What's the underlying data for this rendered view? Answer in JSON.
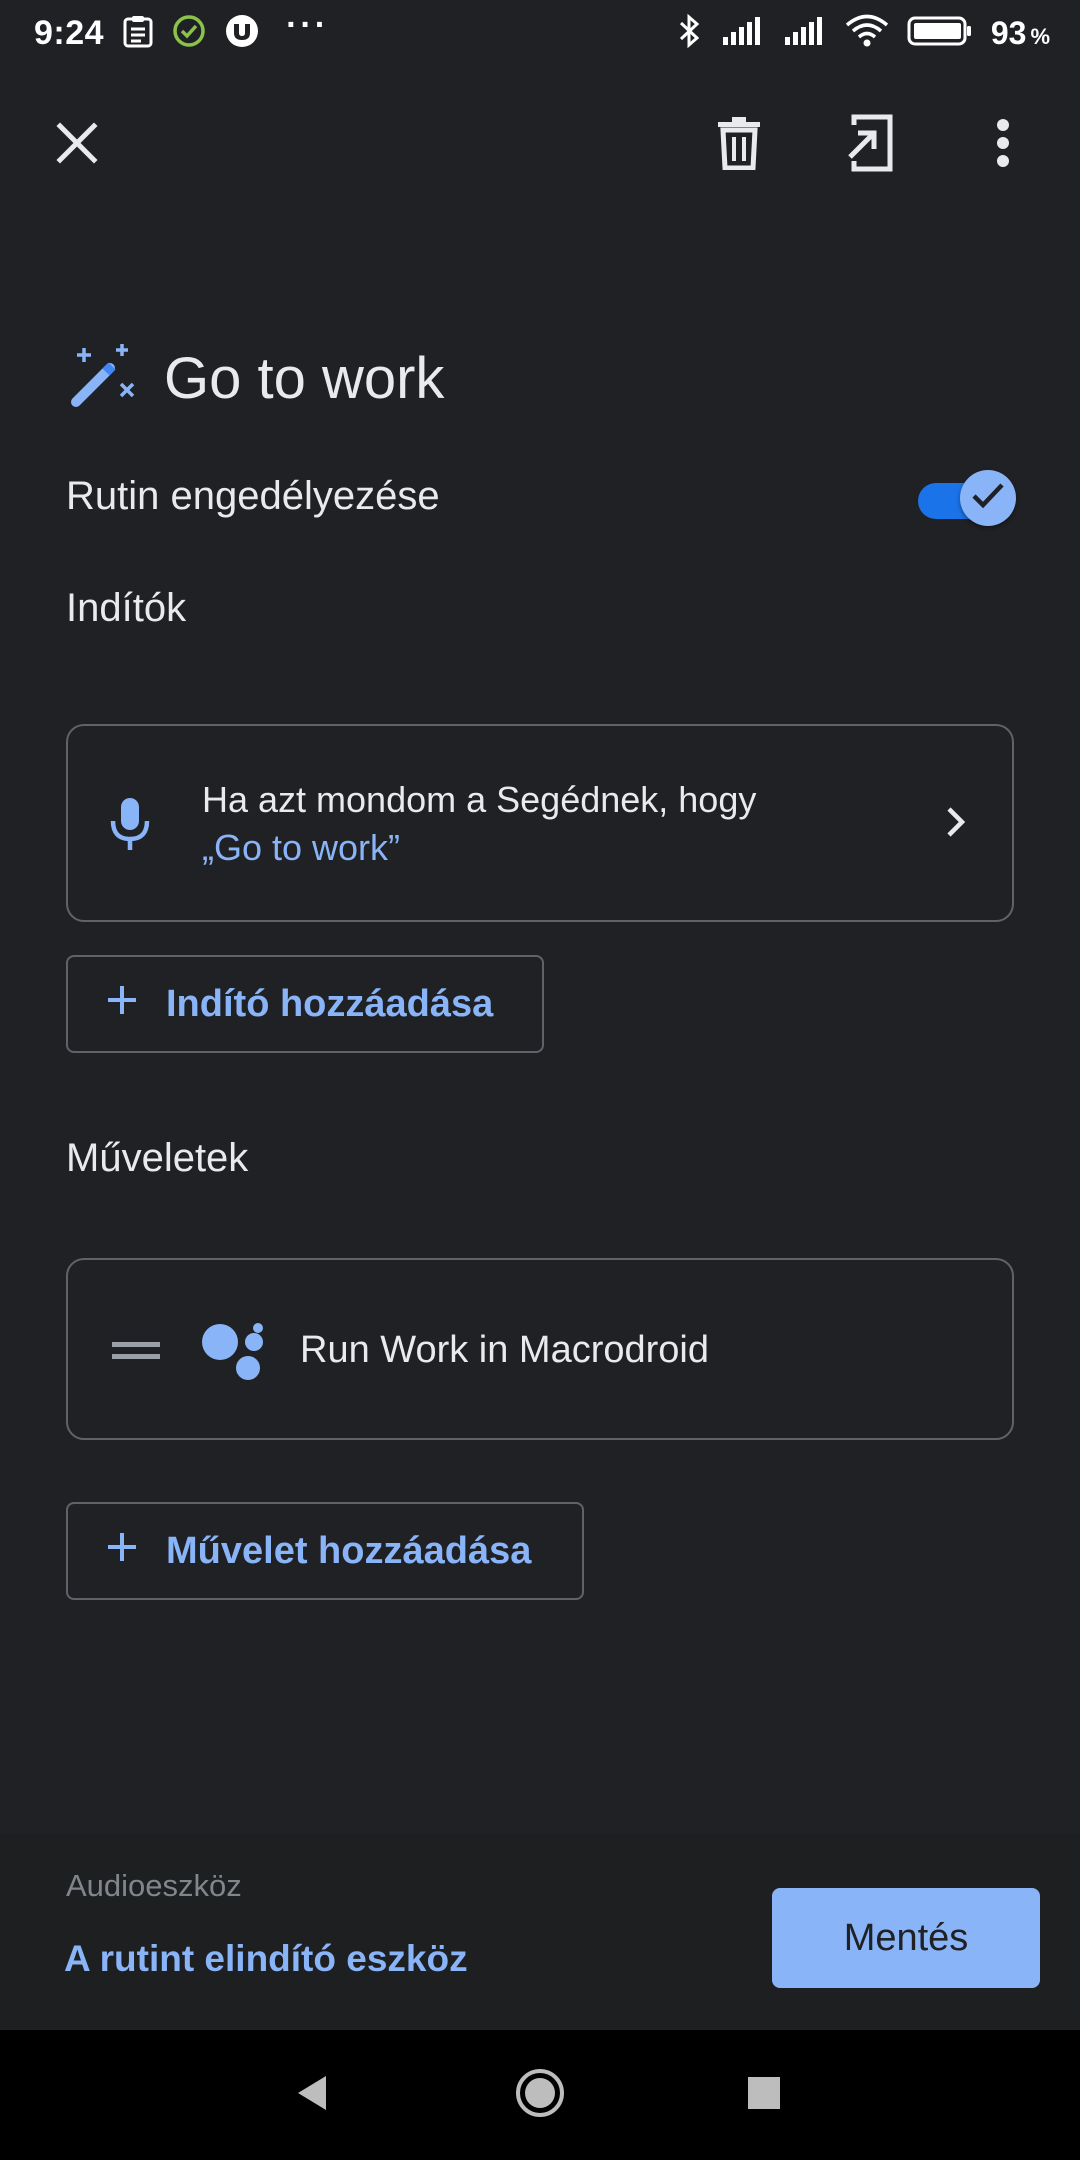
{
  "status_bar": {
    "time": "9:24",
    "overflow": "···",
    "battery_percent": "93",
    "battery_unit": "%",
    "icons": [
      "clipboard-icon",
      "check-circle-icon",
      "utorrent-icon",
      "bluetooth-icon",
      "signal-icon",
      "signal-icon",
      "wifi-icon",
      "battery-icon"
    ],
    "check_color": "#8bc34a"
  },
  "app_bar": {
    "icons": [
      "close-icon",
      "delete-icon",
      "shortcut-icon",
      "more-vert-icon"
    ]
  },
  "routine": {
    "icon": "magic-wand-icon",
    "title": "Go to work",
    "enable_label": "Rutin engedélyezése",
    "enabled": true
  },
  "starters": {
    "section_title": "Indítók",
    "items": [
      {
        "icon": "mic-icon",
        "line1": "Ha azt mondom a Segédnek, hogy",
        "line2": "„Go to work”"
      }
    ],
    "add_label": "Indító hozzáadása"
  },
  "actions": {
    "section_title": "Műveletek",
    "items": [
      {
        "icon": "google-assistant-icon",
        "label": "Run Work in Macrodroid"
      }
    ],
    "add_label": "Művelet hozzáadása"
  },
  "bottom": {
    "audio_label": "Audioeszköz",
    "device_link": "A rutint elindító eszköz",
    "save_label": "Mentés"
  },
  "colors": {
    "background": "#202124",
    "accent": "#8ab4f8",
    "toggle_track": "#1a73e8",
    "outline": "#5f6368"
  }
}
